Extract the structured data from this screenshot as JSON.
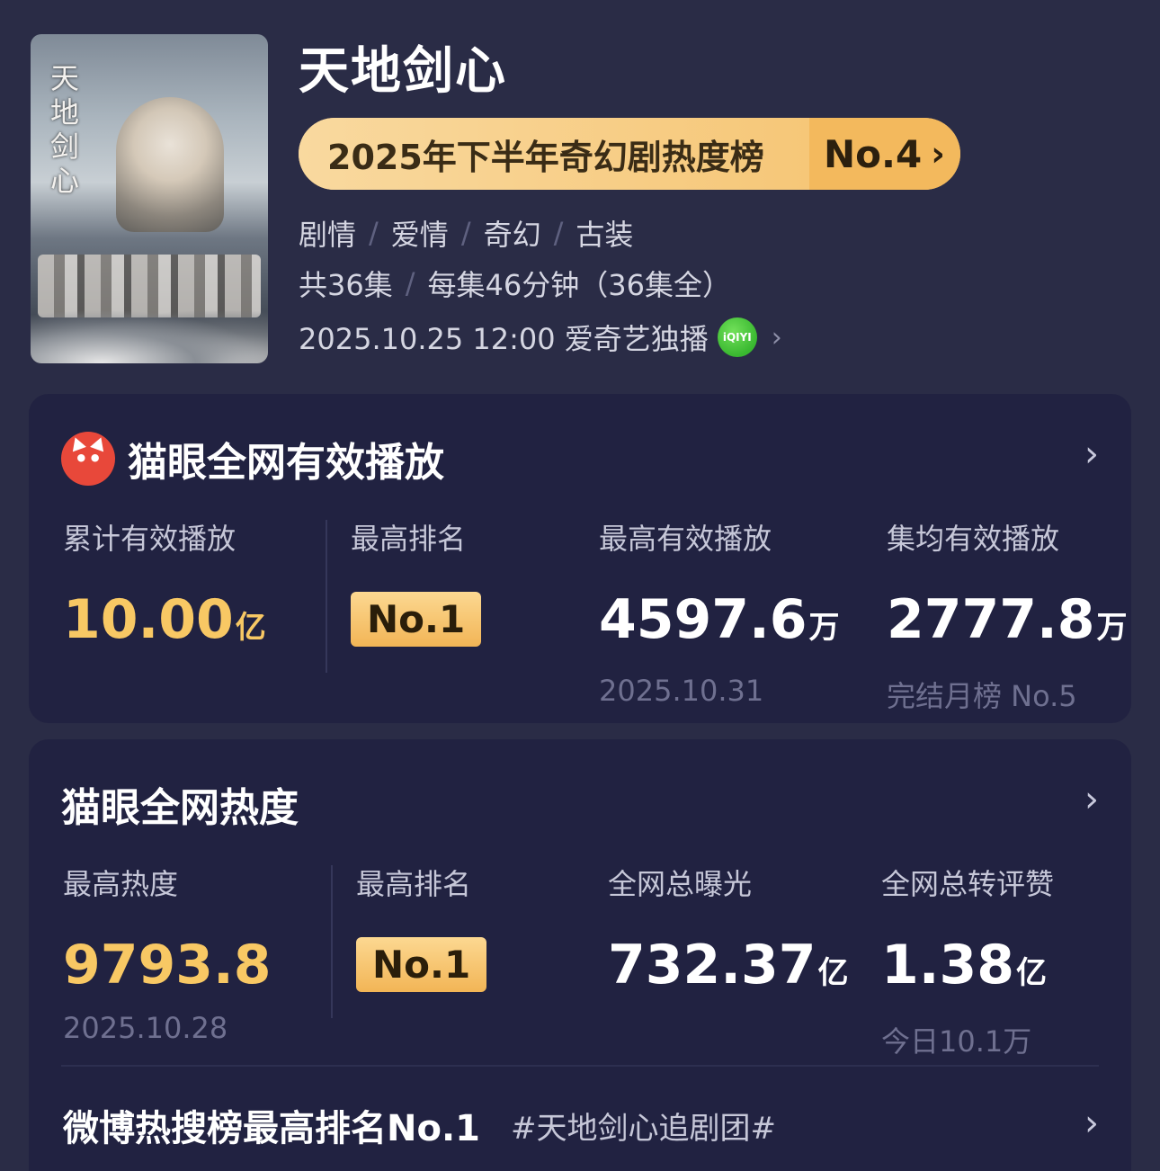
{
  "poster": {
    "calligraphy": "天地剑心",
    "alt": "poster"
  },
  "show": {
    "title": "天地剑心",
    "rank_label": "2025年下半年奇幻剧热度榜",
    "rank_value": "No.4",
    "genres": [
      "剧情",
      "爱情",
      "奇幻",
      "古装"
    ],
    "episodes_total": "共36集",
    "episode_detail": "每集46分钟（36集全）",
    "release": "2025.10.25 12:00 爱奇艺独播",
    "platform_icon_text": "iQIYI"
  },
  "card1": {
    "title": "猫眼全网有效播放",
    "icon": "cat-icon",
    "stats": {
      "cumulative": {
        "label": "累计有效播放",
        "value": "10.00",
        "unit": "亿"
      },
      "top_rank": {
        "label": "最高排名",
        "value": "No.1"
      },
      "peak_play": {
        "label": "最高有效播放",
        "value": "4597.6",
        "unit": "万",
        "sub": "2025.10.31"
      },
      "avg_play": {
        "label": "集均有效播放",
        "value": "2777.8",
        "unit": "万",
        "sub": "完结月榜 No.5"
      }
    }
  },
  "card2": {
    "title": "猫眼全网热度",
    "stats": {
      "peak_heat": {
        "label": "最高热度",
        "value": "9793.8",
        "sub": "2025.10.28"
      },
      "top_rank": {
        "label": "最高排名",
        "value": "No.1"
      },
      "exposure": {
        "label": "全网总曝光",
        "value": "732.37",
        "unit": "亿"
      },
      "engagement": {
        "label": "全网总转评赞",
        "value": "1.38",
        "unit": "亿",
        "sub": "今日10.1万"
      }
    },
    "weibo": {
      "main": "微博热搜榜最高排名No.1",
      "tag": "#天地剑心追剧团#"
    }
  },
  "colors": {
    "background": "#2a2c46",
    "card": "#212241",
    "gold": "#f8c864",
    "pill": "#f7c87a"
  }
}
